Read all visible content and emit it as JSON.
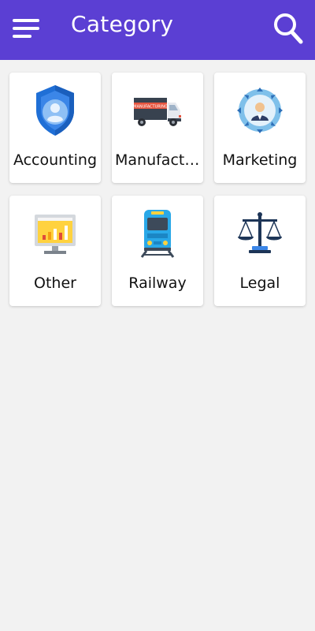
{
  "appbar": {
    "title": "Category",
    "background": "#5b3fd3",
    "menu_icon": "hamburger-menu-icon",
    "search_icon": "search-icon"
  },
  "categories": [
    {
      "label": "Accounting",
      "icon": "shield-user-icon"
    },
    {
      "label": "Manufactu...",
      "icon": "manufacturing-truck-icon",
      "truck_text": "MANUFACTURING"
    },
    {
      "label": "Marketing",
      "icon": "marketing-target-icon"
    },
    {
      "label": "Other",
      "icon": "monitor-chart-icon"
    },
    {
      "label": "Railway",
      "icon": "train-icon"
    },
    {
      "label": "Legal",
      "icon": "scales-icon"
    }
  ]
}
